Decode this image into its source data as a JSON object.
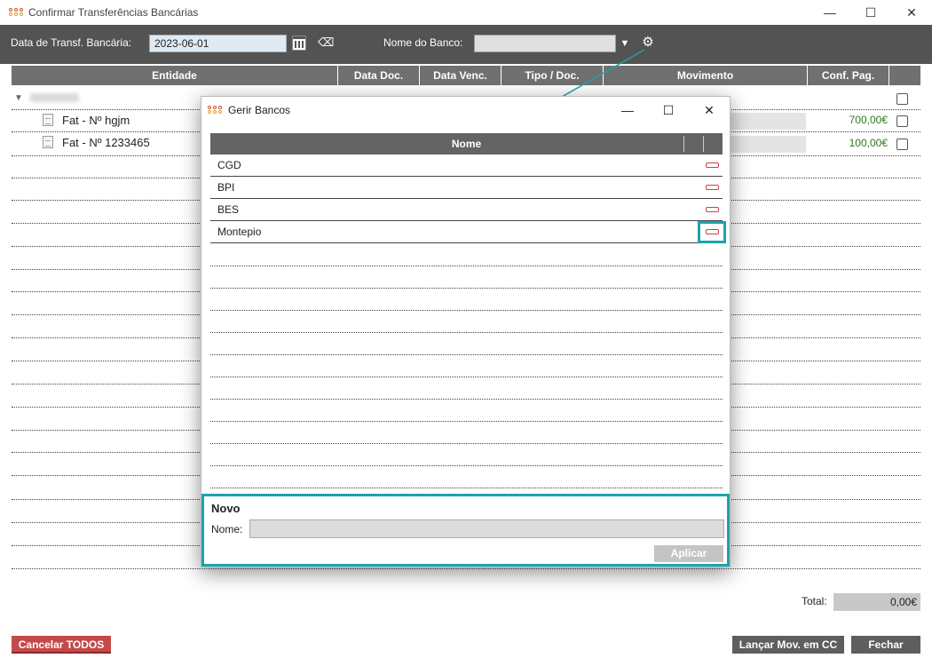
{
  "window": {
    "title": "Confirmar Transferências Bancárias",
    "minimize": "—",
    "maximize": "☐",
    "close": "✕"
  },
  "toolbar": {
    "date_label": "Data de Transf. Bancária:",
    "date_value": "2023-06-01",
    "bank_label": "Nome do Banco:",
    "bank_value": ""
  },
  "grid": {
    "columns": [
      "Entidade",
      "Data Doc.",
      "Data Venc.",
      "Tipo / Doc.",
      "Movimento",
      "Conf. Pag."
    ],
    "rows": [
      {
        "label": "Fat - Nº hgjm",
        "amount": "700,00€"
      },
      {
        "label": "Fat - Nº 1233465",
        "amount": "100,00€"
      }
    ]
  },
  "footer": {
    "total_label": "Total:",
    "total_value": "0,00€",
    "cancel_all": "Cancelar TODOS",
    "launch": "Lançar Mov. em CC",
    "close": "Fechar"
  },
  "dialog": {
    "title": "Gerir Bancos",
    "column": "Nome",
    "banks": [
      "CGD",
      "BPI",
      "BES",
      "Montepio"
    ],
    "novo_title": "Novo",
    "nome_label": "Nome:",
    "nome_value": "",
    "apply": "Aplicar"
  },
  "colors": {
    "toolbar_bg": "#535353",
    "highlight": "#1fa2ad",
    "amount_green": "#2c7a1d",
    "cancel_red": "#c44a4a"
  }
}
